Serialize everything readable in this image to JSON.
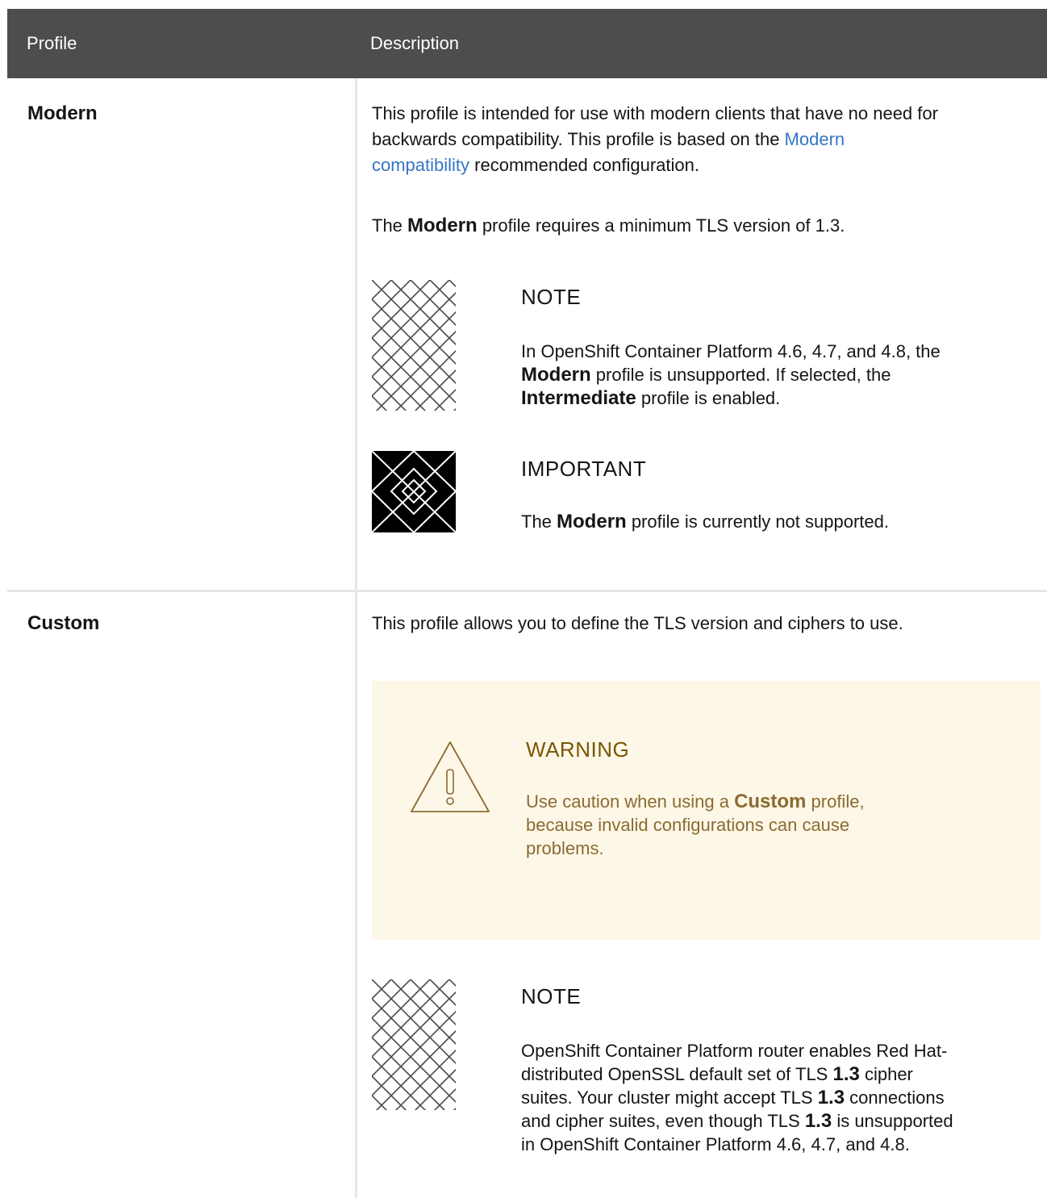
{
  "table": {
    "headers": {
      "profile": "Profile",
      "description": "Description"
    },
    "rows": {
      "modern": {
        "name": "Modern",
        "intro": {
          "t1": "This profile is intended for use with modern clients that have no need for",
          "t2": "backwards compatibility. This profile is based on the ",
          "link1": "Modern",
          "link2": "compatibility",
          "t3": " recommended configuration."
        },
        "requirement": {
          "t1": "The ",
          "b": "Modern",
          "t2": " profile requires a minimum TLS version of 1.3."
        },
        "note": {
          "title": "NOTE",
          "l1": "In OpenShift Container Platform 4.6, 4.7, and 4.8, the",
          "b1": "Modern",
          "l2": " profile is unsupported. If selected, the",
          "b2": "Intermediate",
          "l3": " profile is enabled."
        },
        "important": {
          "title": "IMPORTANT",
          "t1": "The ",
          "b": "Modern",
          "t2": " profile is currently not supported."
        }
      },
      "custom": {
        "name": "Custom",
        "intro": "This profile allows you to define the TLS version and ciphers to use.",
        "warning": {
          "title": "WARNING",
          "t1": "Use caution when using a ",
          "b": "Custom",
          "t2": " profile,",
          "l2": "because invalid configurations can cause",
          "l3": "problems."
        },
        "note": {
          "title": "NOTE",
          "l1": "OpenShift Container Platform router enables Red Hat-",
          "l2a": "distributed OpenSSL default set of TLS ",
          "l2b": "1.3",
          "l2c": " cipher",
          "l3a": "suites. Your cluster might accept TLS ",
          "l3b": "1.3",
          "l3c": " connections",
          "l4a": "and cipher suites, even though TLS ",
          "l4b": "1.3",
          "l4c": " is unsupported",
          "l5": "in OpenShift Container Platform 4.6, 4.7, and 4.8."
        }
      }
    }
  },
  "colors": {
    "header_bg": "#4d4d4d",
    "link": "#3576c5",
    "warning_bg": "#fdf7e7",
    "warning_text": "#795600",
    "border": "#e7e7e7"
  },
  "icons": {
    "note": "note-pattern-icon",
    "important": "important-pattern-icon",
    "warning": "warning-triangle-icon"
  }
}
